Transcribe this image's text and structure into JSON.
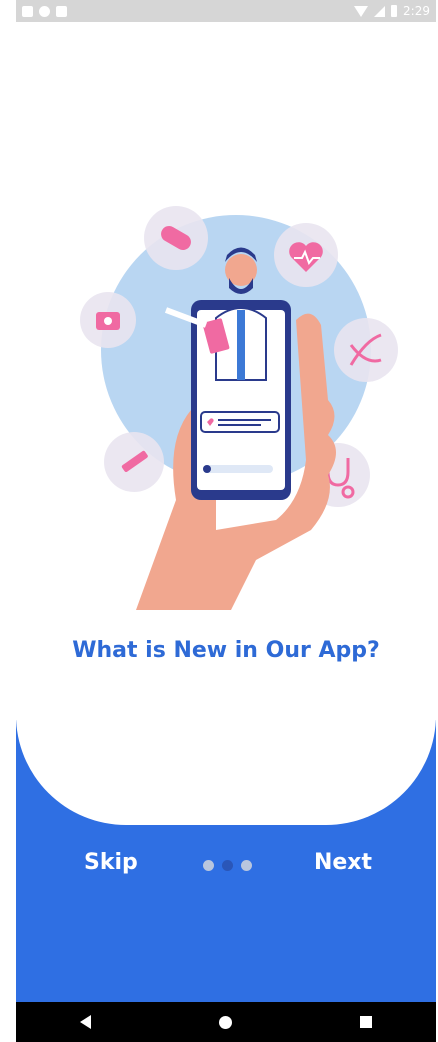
{
  "status_bar": {
    "time": "2:29",
    "left_icons": [
      "image-icon",
      "circle-icon",
      "sd-card-icon"
    ],
    "right_icons": [
      "wifi-icon",
      "signal-icon",
      "battery-icon"
    ]
  },
  "onboarding": {
    "title": "What is New in Our App?",
    "skip_label": "Skip",
    "next_label": "Next",
    "page_count": 3,
    "active_page": 2
  },
  "colors": {
    "primary": "#2f6fe3",
    "title": "#2e6ad6",
    "dot_active": "#2a56b8",
    "dot_inactive": "#b9c6de"
  },
  "system_nav": {
    "buttons": [
      "back-icon",
      "home-icon",
      "recents-icon"
    ]
  }
}
